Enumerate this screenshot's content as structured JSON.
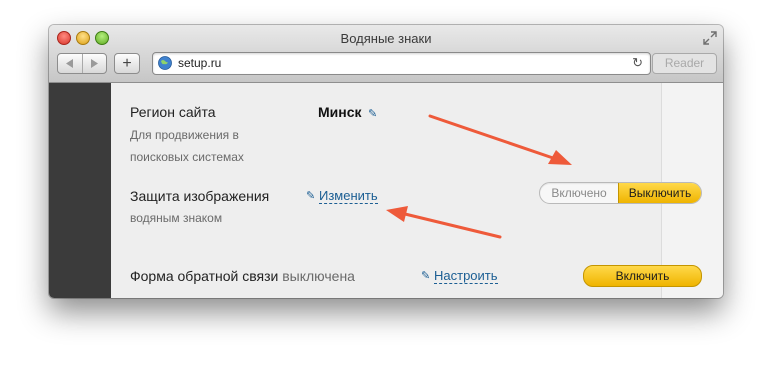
{
  "window": {
    "title": "Водяные знаки",
    "url": "setup.ru",
    "reader_label": "Reader",
    "add_label": "+",
    "reload_icon": "reload-icon"
  },
  "settings": {
    "region": {
      "label": "Регион сайта",
      "desc_line1": "Для продвижения в",
      "desc_line2": "поисковых системах",
      "value": "Минск"
    },
    "image_protection": {
      "label": "Защита изображения",
      "desc": "водяным знаком",
      "change_link": "Изменить",
      "toggle_on": "Включено",
      "toggle_off": "Выключить",
      "state": "off"
    },
    "feedback_form": {
      "label": "Форма обратной связи",
      "status": "выключена",
      "configure_link": "Настроить",
      "enable_button": "Включить"
    }
  },
  "colors": {
    "accent_yellow": "#f5c518",
    "link_blue": "#1b5e93",
    "annotation_arrow": "#ee5a3a",
    "sidebar_dark": "#3b3b3b"
  }
}
